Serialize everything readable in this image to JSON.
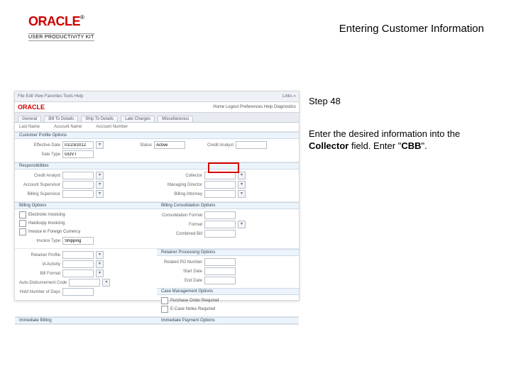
{
  "header": {
    "brand": "ORACLE",
    "brand_tm": "®",
    "brand_sub": "USER PRODUCTIVITY KIT",
    "title": "Entering Customer Information"
  },
  "instructions": {
    "step_label": "Step 48",
    "line1a": "Enter the desired information into the ",
    "line1b_bold": "Collector",
    "line1c": " field. Enter \"",
    "line1d_bold": "CBB",
    "line1e": "\"."
  },
  "shot": {
    "blue_left": "File   Edit   View   Favorites   Tools   Help",
    "blue_right": "Links »",
    "brand": "ORACLE",
    "brand_links": "Home   Logout   Preferences   Help   Diagnostics",
    "tabs": [
      "General",
      "Bill To Details",
      "Ship To Details",
      "Late Charges",
      "Miscellaneous"
    ],
    "sub_left": "Last Name",
    "sub_mid": "Account Name",
    "sub_right": "Account Number",
    "sect_profile": "Customer Profile Options",
    "eff_date_lbl": "Effective Date",
    "eff_date_val": "01/23/2012",
    "status_lbl": "Status",
    "status_val": "Active",
    "credit_lbl": "Credit Analyst",
    "sale_lbl": "Sale Type",
    "sale_val": "GOVT",
    "sect_resp": "Responsibilities",
    "credit_analyst_lbl": "Credit Analyst",
    "collector_lbl": "Collector",
    "acct_sup_lbl": "Account Supervisor",
    "mgr_lbl": "Managing Director",
    "bill_sup_lbl": "Billing Supervisor",
    "bill_att_lbl": "Billing Attorney",
    "sect_bill_l": "Billing Options",
    "sect_bill_r": "Billing Consolidation Options",
    "chk_elec": "Electronic Invoicing",
    "chk_hc": "Hardcopy Invoicing",
    "chk_fc": "Invoice in Foreign Currency",
    "consol_lbl": "Consolidation Format",
    "format_lbl": "Format",
    "combined_lbl": "Combined Bill",
    "inv_type_lbl": "Invoice Type",
    "inv_type_val": "Shipping",
    "sect_ret_r": "Retainer Processing Options",
    "retainer_lbl": "Retainer Profile",
    "ret_num_lbl": "Related PO Number",
    "sect_ret_l": "",
    "ia_lbl": "IA Activity",
    "start_lbl": "Start Date",
    "bill_fmt_lbl": "Bill Format",
    "end_lbl": "End Date",
    "autoconv_lbl": "Auto-Disbursement Code",
    "sect_cm": "Case Management Options",
    "hold_lbl": "Hold Number of Days",
    "chk_po": "Purchase Order Required",
    "chk_ecase": "E-Case Notes Required",
    "sect_imm_l": "Immediate Billing",
    "sect_imm_r": "Immediate Payment Options"
  }
}
